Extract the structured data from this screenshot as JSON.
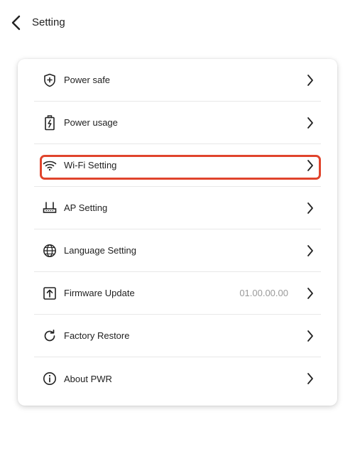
{
  "header": {
    "back_icon": "chevron-left-icon",
    "title": "Setting"
  },
  "settings": {
    "items": [
      {
        "label": "Power safe",
        "icon": "shield-plus-icon",
        "value": ""
      },
      {
        "label": "Power usage",
        "icon": "battery-bolt-icon",
        "value": ""
      },
      {
        "label": "Wi-Fi Setting",
        "icon": "wifi-icon",
        "value": "",
        "highlighted": true
      },
      {
        "label": "AP Setting",
        "icon": "router-icon",
        "value": ""
      },
      {
        "label": "Language Setting",
        "icon": "globe-icon",
        "value": ""
      },
      {
        "label": "Firmware Update",
        "icon": "upload-icon",
        "value": "01.00.00.00"
      },
      {
        "label": "Factory Restore",
        "icon": "refresh-icon",
        "value": ""
      },
      {
        "label": "About PWR",
        "icon": "info-icon",
        "value": ""
      }
    ]
  },
  "colors": {
    "highlight": "#e0442c",
    "divider": "#e8e8e8",
    "muted_text": "#9a9a9a"
  }
}
